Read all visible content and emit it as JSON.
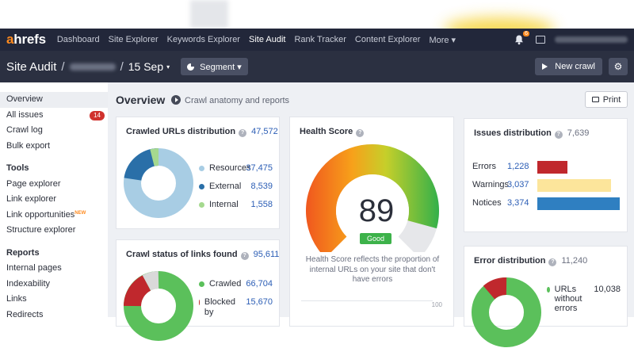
{
  "nav": {
    "logo_a": "a",
    "logo_rest": "hrefs",
    "items": [
      "Dashboard",
      "Site Explorer",
      "Keywords Explorer",
      "Site Audit",
      "Rank Tracker",
      "Content Explorer",
      "More ▾"
    ],
    "active_index": 3,
    "notification_count": "6"
  },
  "subheader": {
    "title": "Site Audit",
    "separator1": "/",
    "separator2": "/",
    "date": "15 Sep",
    "date_caret": "▾",
    "segment_label": "Segment ▾",
    "new_crawl_label": "New crawl"
  },
  "sidebar": {
    "items_top": [
      {
        "label": "Overview",
        "active": true
      },
      {
        "label": "All issues",
        "badge": "14"
      },
      {
        "label": "Crawl log"
      },
      {
        "label": "Bulk export"
      }
    ],
    "tools_heading": "Tools",
    "tools": [
      "Page explorer",
      "Link explorer",
      "Link opportunities",
      "Structure explorer"
    ],
    "new_tag": "NEW",
    "reports_heading": "Reports",
    "reports": [
      "Internal pages",
      "Indexability",
      "Links",
      "Redirects"
    ]
  },
  "overview": {
    "title": "Overview",
    "subtitle": "Crawl anatomy and reports",
    "print_label": "Print"
  },
  "crawled_urls": {
    "title": "Crawled URLs distribution",
    "total": "47,572",
    "legend": [
      {
        "label": "Resources",
        "value": "37,475",
        "color": "#a8cde4"
      },
      {
        "label": "External",
        "value": "8,539",
        "color": "#2a6fa8"
      },
      {
        "label": "Internal",
        "value": "1,558",
        "color": "#a5d98f"
      }
    ]
  },
  "crawl_status": {
    "title": "Crawl status of links found",
    "total": "95,611",
    "legend": [
      {
        "label": "Crawled",
        "value": "66,704",
        "color": "#5bc05b"
      },
      {
        "label": "Blocked by",
        "value": "15,670",
        "color": "#c0282d"
      }
    ]
  },
  "health": {
    "title": "Health Score",
    "score": "89",
    "score_fraction": 0.89,
    "status": "Good",
    "note": "Health Score reflects the proportion of internal URLs on your site that don't have errors",
    "axis_max": "100"
  },
  "issues": {
    "title": "Issues distribution",
    "total": "7,639",
    "rows": [
      {
        "label": "Errors",
        "value": "1,228",
        "color": "#c0282d",
        "fraction": 0.16
      },
      {
        "label": "Warnings",
        "value": "3,037",
        "color": "#fce59b",
        "fraction": 0.4
      },
      {
        "label": "Notices",
        "value": "3,374",
        "color": "#2f7fc1",
        "fraction": 0.44
      }
    ]
  },
  "errors": {
    "title": "Error distribution",
    "total": "11,240",
    "legend": [
      {
        "label": "URLs without errors",
        "value": "10,038",
        "color": "#5bc05b"
      }
    ]
  },
  "colors": {
    "nav_bg": "#22273a",
    "subheader_bg": "#2b3041",
    "accent": "#ff8a1e",
    "link_blue": "#2b5db5",
    "good_green": "#3db24a"
  }
}
